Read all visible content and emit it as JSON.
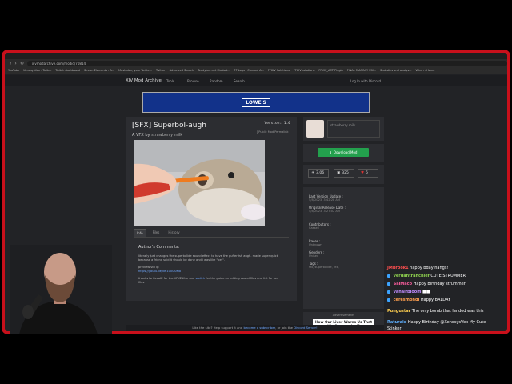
{
  "browser": {
    "url": "xivmodarchive.com/modid/70814",
    "bookmarks": [
      "YouTube",
      "XenosysVex - Twitch",
      "Twitch dashboard",
      "StreamElements - A...",
      "Mastodon, your Twitte...",
      "Twitter",
      "Advanced Search",
      "TeddyLee.net Mastod...",
      "FF Logs - Combat A...",
      "FFXIV Solutions",
      "FFXIV rotations",
      "FFXIV_ACT Plugin",
      "FINAL FANTASY XIV...",
      "Statistics and analys...",
      "When - Home"
    ]
  },
  "site": {
    "brand": "XIV Mod Archive",
    "nav": [
      "Tools",
      "Browse",
      "Random",
      "Search"
    ],
    "login": "Log In with Discord"
  },
  "ad_top": {
    "logo": "LOWE'S"
  },
  "mod": {
    "title": "[SFX] Superbol-augh",
    "version": "Version: 1.0",
    "permalink": "[ Public Mod Permalink ]",
    "by_prefix": "A VFX by",
    "author": "strawberry milk",
    "tabs": [
      "Info",
      "Files",
      "History"
    ],
    "comments_title": "Author's Comments:",
    "comment_line1": "literally just changes the superbolide sound effect to have the pufferfish augh. made super quick because a friend said it should be done and i was like \"bet\".",
    "comment_preview_label": "preview vid lg:",
    "comment_link": "https://youtu.be/vel1000i0Mo",
    "comment_thanks_prefix": "thanks to OccaIX for the VFXEditor and",
    "comment_thanks_link": "sadich",
    "comment_thanks_suffix": "for the guide on editing sound files and list for scd files"
  },
  "sidebar": {
    "author_name": "strawberry milk",
    "download_label": "Download Mod",
    "stats": {
      "views": "3.06",
      "downloads": "325",
      "likes": "6"
    },
    "info": [
      {
        "label": "Last Version Update :",
        "value": "5/8/2023, 3:42:28 AM"
      },
      {
        "label": "Original Release Date :",
        "value": "5/8/2023, 3:27:02 AM"
      },
      {
        "label": "Contributors :",
        "value": "Cassell"
      },
      {
        "label": "Races :",
        "value": "Unknown"
      },
      {
        "label": "Genders :",
        "value": "Unisex"
      },
      {
        "label": "Tags :",
        "value": "sfx, superbolide, vfx,"
      }
    ],
    "advert_label": "Advertisements",
    "advert_text": "How Our Liver Warns Us That It's Overworked?"
  },
  "footer": {
    "prefix": "Like the site? Help support it and",
    "link1": "become a subscriber",
    "middle": ", or join the",
    "link2": "Discord Server!"
  },
  "chat": [
    {
      "name": "JMbrook1",
      "text": "happy bday hangs!",
      "color": "#ff4f4f"
    },
    {
      "name": "verdantranchief",
      "text": "CUTE STRUMMER",
      "color": "#8fd14f"
    },
    {
      "name": "SaiMaco",
      "text": "Happy Birthday strummer",
      "color": "#ff5fa0"
    },
    {
      "name": "vanaifbloom",
      "text": "",
      "color": "#c08cff"
    },
    {
      "name": "ceresmondi",
      "text": "Happy BALDAY",
      "color": "#ff9f4f"
    },
    {
      "name": "Pungustar",
      "text": "The only bomb that landed was this",
      "color": "#ffcf4f"
    },
    {
      "name": "Raturaid",
      "text": "Happy Birthday @XenosysVex My Cute",
      "color": "#5fb0ff"
    },
    {
      "name": "",
      "text": "Stinker!",
      "color": "#5fb0ff"
    }
  ]
}
